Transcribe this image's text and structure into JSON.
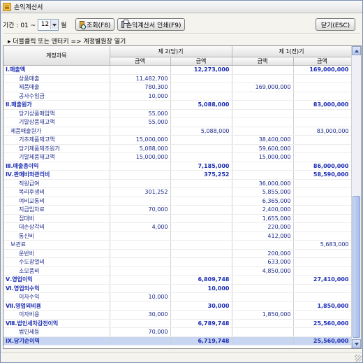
{
  "window": {
    "title": "손익계산서"
  },
  "toolbar": {
    "period_label": "기간 : 01 ~",
    "month_value": "12",
    "month_suffix": "월",
    "search_label": "조회(F8)",
    "print_label": "손익계산서 인쇄(F9)",
    "close_label": "닫기(ESC)"
  },
  "hint": "▸ 더블클릭 또는 엔터키 => 계정별원장 열기",
  "table": {
    "col_account": "계정과목",
    "col_current": "제 2(당)기",
    "col_previous": "제 1(전)기",
    "sub_amount": "금액",
    "rows": [
      {
        "name": "Ⅰ.매출액",
        "c1": "",
        "c2": "12,273,000",
        "p1": "",
        "p2": "169,000,000",
        "s": 1
      },
      {
        "name": "상품매출",
        "c1": "11,482,700",
        "c2": "",
        "p1": "",
        "p2": "",
        "s": 0,
        "i": 2
      },
      {
        "name": "제품매출",
        "c1": "780,300",
        "c2": "",
        "p1": "169,000,000",
        "p2": "",
        "s": 0,
        "i": 2
      },
      {
        "name": "공사수입금",
        "c1": "10,000",
        "c2": "",
        "p1": "",
        "p2": "",
        "s": 0,
        "i": 2
      },
      {
        "name": "Ⅱ.매출원가",
        "c1": "",
        "c2": "5,088,000",
        "p1": "",
        "p2": "83,000,000",
        "s": 1
      },
      {
        "name": "당기상품매입액",
        "c1": "55,000",
        "c2": "",
        "p1": "",
        "p2": "",
        "s": 0,
        "i": 2
      },
      {
        "name": "기말상품재고액",
        "c1": "55,000",
        "c2": "",
        "p1": "",
        "p2": "",
        "s": 0,
        "i": 2
      },
      {
        "name": "제품매출원가",
        "c1": "",
        "c2": "5,088,000",
        "p1": "",
        "p2": "83,000,000",
        "s": 0,
        "i": 1
      },
      {
        "name": "기초제품재고액",
        "c1": "15,000,000",
        "c2": "",
        "p1": "38,400,000",
        "p2": "",
        "s": 0,
        "i": 2
      },
      {
        "name": "당기제품제조원가",
        "c1": "5,088,000",
        "c2": "",
        "p1": "59,600,000",
        "p2": "",
        "s": 0,
        "i": 2
      },
      {
        "name": "기말제품재고액",
        "c1": "15,000,000",
        "c2": "",
        "p1": "15,000,000",
        "p2": "",
        "s": 0,
        "i": 2
      },
      {
        "name": "Ⅲ.매출총이익",
        "c1": "",
        "c2": "7,185,000",
        "p1": "",
        "p2": "86,000,000",
        "s": 1
      },
      {
        "name": "Ⅳ.판매비와관리비",
        "c1": "",
        "c2": "375,252",
        "p1": "",
        "p2": "58,590,000",
        "s": 1
      },
      {
        "name": "직원급여",
        "c1": "",
        "c2": "",
        "p1": "36,000,000",
        "p2": "",
        "s": 0,
        "i": 2
      },
      {
        "name": "복리후생비",
        "c1": "301,252",
        "c2": "",
        "p1": "5,855,000",
        "p2": "",
        "s": 0,
        "i": 2
      },
      {
        "name": "여비교통비",
        "c1": "",
        "c2": "",
        "p1": "6,365,000",
        "p2": "",
        "s": 0,
        "i": 2
      },
      {
        "name": "지급임차료",
        "c1": "70,000",
        "c2": "",
        "p1": "2,400,000",
        "p2": "",
        "s": 0,
        "i": 2
      },
      {
        "name": "접대비",
        "c1": "",
        "c2": "",
        "p1": "1,655,000",
        "p2": "",
        "s": 0,
        "i": 2
      },
      {
        "name": "대손상각비",
        "c1": "4,000",
        "c2": "",
        "p1": "220,000",
        "p2": "",
        "s": 0,
        "i": 2
      },
      {
        "name": "통신비",
        "c1": "",
        "c2": "",
        "p1": "412,000",
        "p2": "",
        "s": 0,
        "i": 2
      },
      {
        "name": "보관료",
        "c1": "",
        "c2": "",
        "p1": "",
        "p2": "5,683,000",
        "s": 0,
        "i": 1
      },
      {
        "name": "운반비",
        "c1": "",
        "c2": "",
        "p1": "200,000",
        "p2": "",
        "s": 0,
        "i": 2
      },
      {
        "name": "수도광열비",
        "c1": "",
        "c2": "",
        "p1": "633,000",
        "p2": "",
        "s": 0,
        "i": 2
      },
      {
        "name": "소모품비",
        "c1": "",
        "c2": "",
        "p1": "4,850,000",
        "p2": "",
        "s": 0,
        "i": 2
      },
      {
        "name": "Ⅴ.영업이익",
        "c1": "",
        "c2": "6,809,748",
        "p1": "",
        "p2": "27,410,000",
        "s": 1
      },
      {
        "name": "Ⅵ.영업외수익",
        "c1": "",
        "c2": "10,000",
        "p1": "",
        "p2": "",
        "s": 1
      },
      {
        "name": "이자수익",
        "c1": "10,000",
        "c2": "",
        "p1": "",
        "p2": "",
        "s": 0,
        "i": 2
      },
      {
        "name": "Ⅶ.영업외비용",
        "c1": "",
        "c2": "30,000",
        "p1": "",
        "p2": "1,850,000",
        "s": 1
      },
      {
        "name": "이자비용",
        "c1": "30,000",
        "c2": "",
        "p1": "1,850,000",
        "p2": "",
        "s": 0,
        "i": 2
      },
      {
        "name": "Ⅷ.법인세차감전이익",
        "c1": "",
        "c2": "6,789,748",
        "p1": "",
        "p2": "25,560,000",
        "s": 1
      },
      {
        "name": "법인세등",
        "c1": "70,000",
        "c2": "",
        "p1": "",
        "p2": "",
        "s": 0,
        "i": 2
      },
      {
        "name": "Ⅸ.당기순이익",
        "c1": "",
        "c2": "6,719,748",
        "p1": "",
        "p2": "25,560,000",
        "s": 1,
        "sel": 1
      }
    ]
  }
}
